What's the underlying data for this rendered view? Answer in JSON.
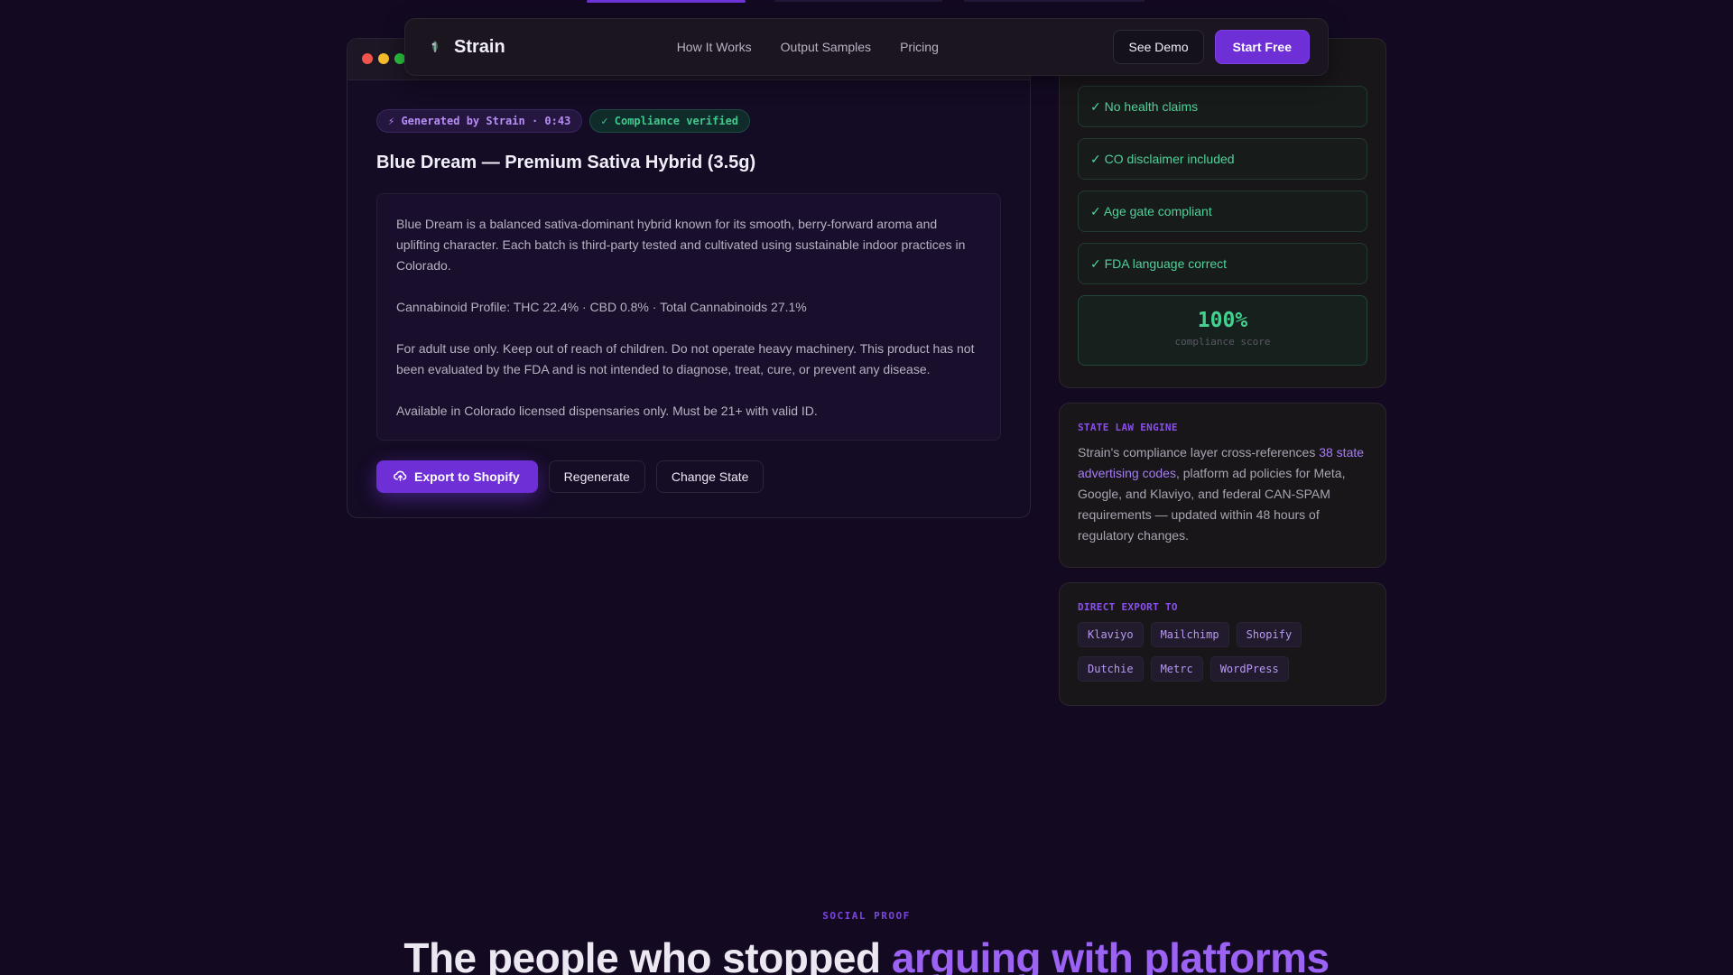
{
  "navbar": {
    "brand": "Strain",
    "links": [
      "How It Works",
      "Output Samples",
      "Pricing"
    ],
    "see_demo": "See Demo",
    "start_free": "Start Free"
  },
  "preview": {
    "badge_generated": "⚡ Generated by Strain · 0:43",
    "badge_compliance": "✓ Compliance verified",
    "product_title": "Blue Dream — Premium Sativa Hybrid (3.5g)",
    "paragraphs": [
      "Blue Dream is a balanced sativa-dominant hybrid known for its smooth, berry-forward aroma and uplifting character. Each batch is third-party tested and cultivated using sustainable indoor practices in Colorado.",
      "Cannabinoid Profile: THC 22.4% · CBD 0.8% · Total Cannabinoids 27.1%",
      "For adult use only. Keep out of reach of children. Do not operate heavy machinery. This product has not been evaluated by the FDA and is not intended to diagnose, treat, cure, or prevent any disease.",
      "Available in Colorado licensed dispensaries only. Must be 21+ with valid ID."
    ],
    "actions": {
      "export": "Export to Shopify",
      "regenerate": "Regenerate",
      "change_state": "Change State"
    }
  },
  "compliance": {
    "checks": [
      "✓ No health claims",
      "✓ CO disclaimer included",
      "✓ Age gate compliant",
      "✓ FDA language correct"
    ],
    "score_value": "100%",
    "score_label": "compliance score"
  },
  "state_law": {
    "label": "STATE LAW ENGINE",
    "text_before": "Strain's compliance layer cross-references ",
    "link": "38 state advertising codes",
    "text_after": ", platform ad policies for Meta, Google, and Klaviyo, and federal CAN-SPAM requirements — updated within 48 hours of regulatory changes."
  },
  "direct_export": {
    "label": "DIRECT EXPORT TO",
    "tags": [
      "Klaviyo",
      "Mailchimp",
      "Shopify",
      "Dutchie",
      "Metrc",
      "WordPress"
    ]
  },
  "social_proof": {
    "eyebrow": "SOCIAL PROOF",
    "headline_start": "The people who stopped ",
    "headline_accent": "arguing with platforms"
  },
  "colors": {
    "background": "#130a22",
    "accent": "#6f2fd6",
    "success": "#43d190"
  }
}
